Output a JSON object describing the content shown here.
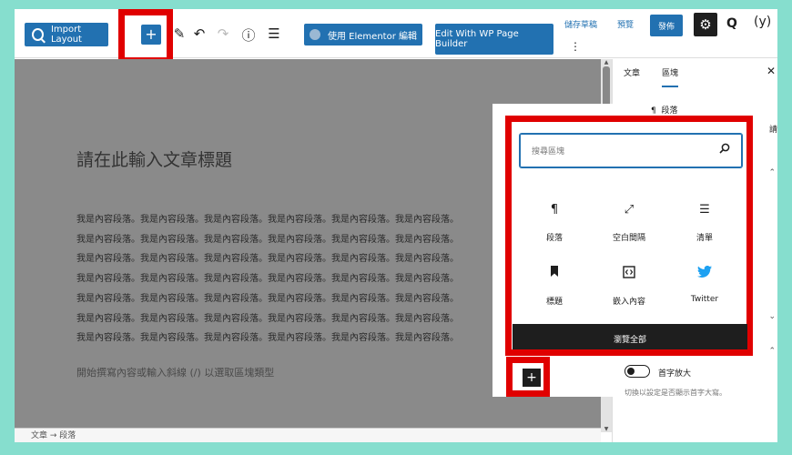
{
  "toolbar": {
    "import_layout": "Import Layout",
    "add_block": "+",
    "elementor": "使用 Elementor 編輯",
    "wp_page_builder": "Edit With WP Page Builder",
    "save_draft": "儲存草稿",
    "preview": "預覽",
    "publish": "發佈",
    "kebab": "⋮",
    "q": "Q",
    "yoast": "(y)"
  },
  "editor": {
    "title": "請在此輸入文章標題",
    "paragraph_lines": [
      "我是內容段落。我是內容段落。我是內容段落。我是內容段落。我是內容段落。我是內容段落。",
      "我是內容段落。我是內容段落。我是內容段落。我是內容段落。我是內容段落。我是內容段落。",
      "我是內容段落。我是內容段落。我是內容段落。我是內容段落。我是內容段落。我是內容段落。",
      "我是內容段落。我是內容段落。我是內容段落。我是內容段落。我是內容段落。我是內容段落。",
      "我是內容段落。我是內容段落。我是內容段落。我是內容段落。我是內容段落。我是內容段落。",
      "我是內容段落。我是內容段落。我是內容段落。我是內容段落。我是內容段落。我是內容段落。",
      "我是內容段落。我是內容段落。我是內容段落。我是內容段落。我是內容段落。我是內容段落。"
    ],
    "hint": "開始撰寫內容或輸入斜線 (/) 以選取區塊類型"
  },
  "footer": {
    "breadcrumb": "文章  →  段落"
  },
  "sidebar": {
    "tab_post": "文章",
    "tab_block": "區塊",
    "block_name": "段落",
    "close": "✕",
    "side_char": "請"
  },
  "inserter": {
    "search_placeholder": "搜尋區塊",
    "blocks": [
      {
        "label": "段落",
        "icon": "¶"
      },
      {
        "label": "空白間隔",
        "icon": "⤢"
      },
      {
        "label": "清單",
        "icon": "☰"
      },
      {
        "label": "標題",
        "icon": "🔖"
      },
      {
        "label": "嵌入內容",
        "icon": "‹›"
      },
      {
        "label": "Twitter",
        "icon": "🐦"
      }
    ],
    "browse_all": "瀏覽全部",
    "bottom_plus": "+"
  },
  "drop_cap": {
    "label": "首字放大",
    "help": "切換以設定是否顯示首字大寫。"
  },
  "colors": {
    "accent": "#2271b1",
    "highlight": "#e00000",
    "background": "#86dece",
    "twitter": "#1da1f2"
  }
}
